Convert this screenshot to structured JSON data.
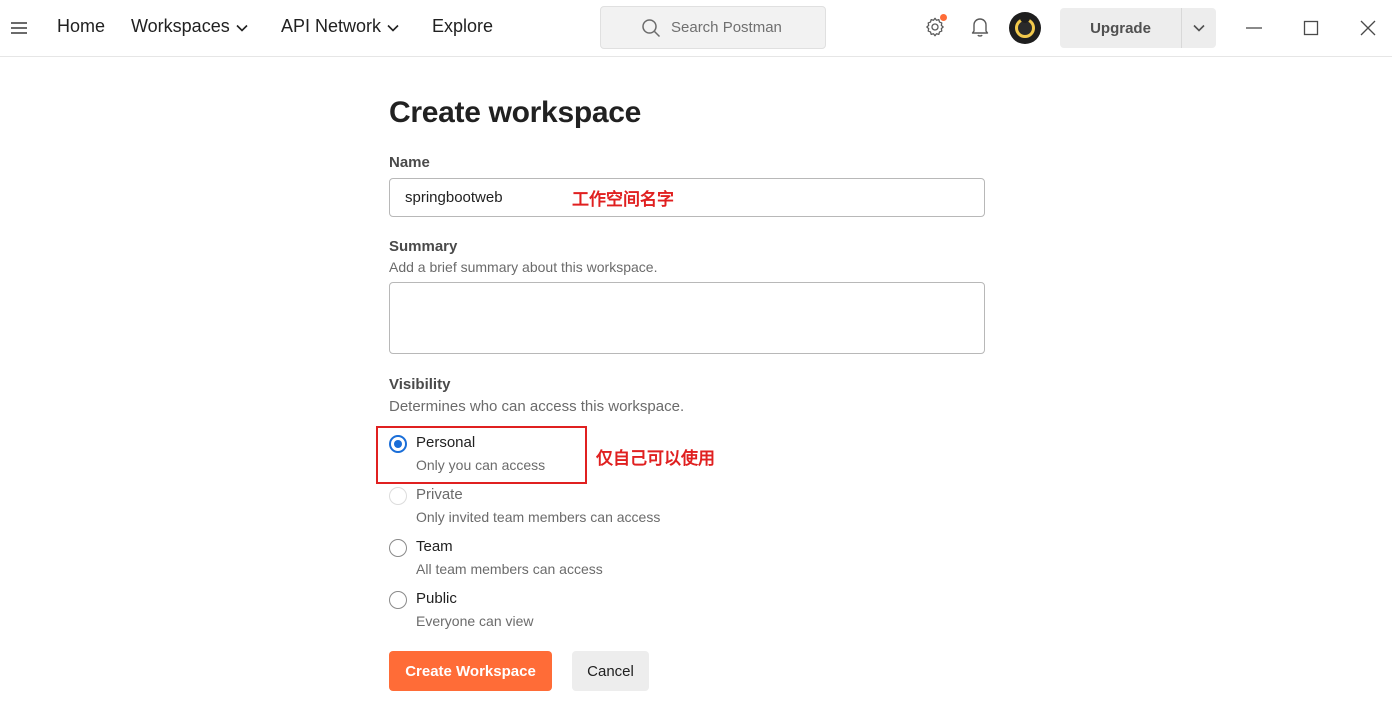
{
  "topbar": {
    "nav": {
      "home": "Home",
      "workspaces": "Workspaces",
      "api_network": "API Network",
      "explore": "Explore"
    },
    "search_placeholder": "Search Postman",
    "upgrade_label": "Upgrade",
    "icons": {
      "menu": "hamburger-menu-icon",
      "search": "search-icon",
      "settings": "gear-icon",
      "notifications": "bell-icon",
      "minimize": "minimize-icon",
      "maximize": "maximize-icon",
      "close": "close-icon"
    },
    "colors": {
      "notification_dot": "#ff6c37"
    }
  },
  "form": {
    "title": "Create workspace",
    "name": {
      "label": "Name",
      "value": "springbootweb",
      "annotation": "工作空间名字"
    },
    "summary": {
      "label": "Summary",
      "help": "Add a brief summary about this workspace.",
      "value": ""
    },
    "visibility": {
      "label": "Visibility",
      "help": "Determines who can access this workspace.",
      "annotation": "仅自己可以使用",
      "options": [
        {
          "label": "Personal",
          "description": "Only you can access",
          "selected": true,
          "disabled": false
        },
        {
          "label": "Private",
          "description": "Only invited team members can access",
          "selected": false,
          "disabled": true
        },
        {
          "label": "Team",
          "description": "All team members can access",
          "selected": false,
          "disabled": false
        },
        {
          "label": "Public",
          "description": "Everyone can view",
          "selected": false,
          "disabled": false
        }
      ]
    },
    "actions": {
      "create_label": "Create Workspace",
      "cancel_label": "Cancel"
    },
    "colors": {
      "primary": "#ff6c37",
      "radio_selected": "#1a6ed8",
      "annotation": "#e02020"
    }
  }
}
